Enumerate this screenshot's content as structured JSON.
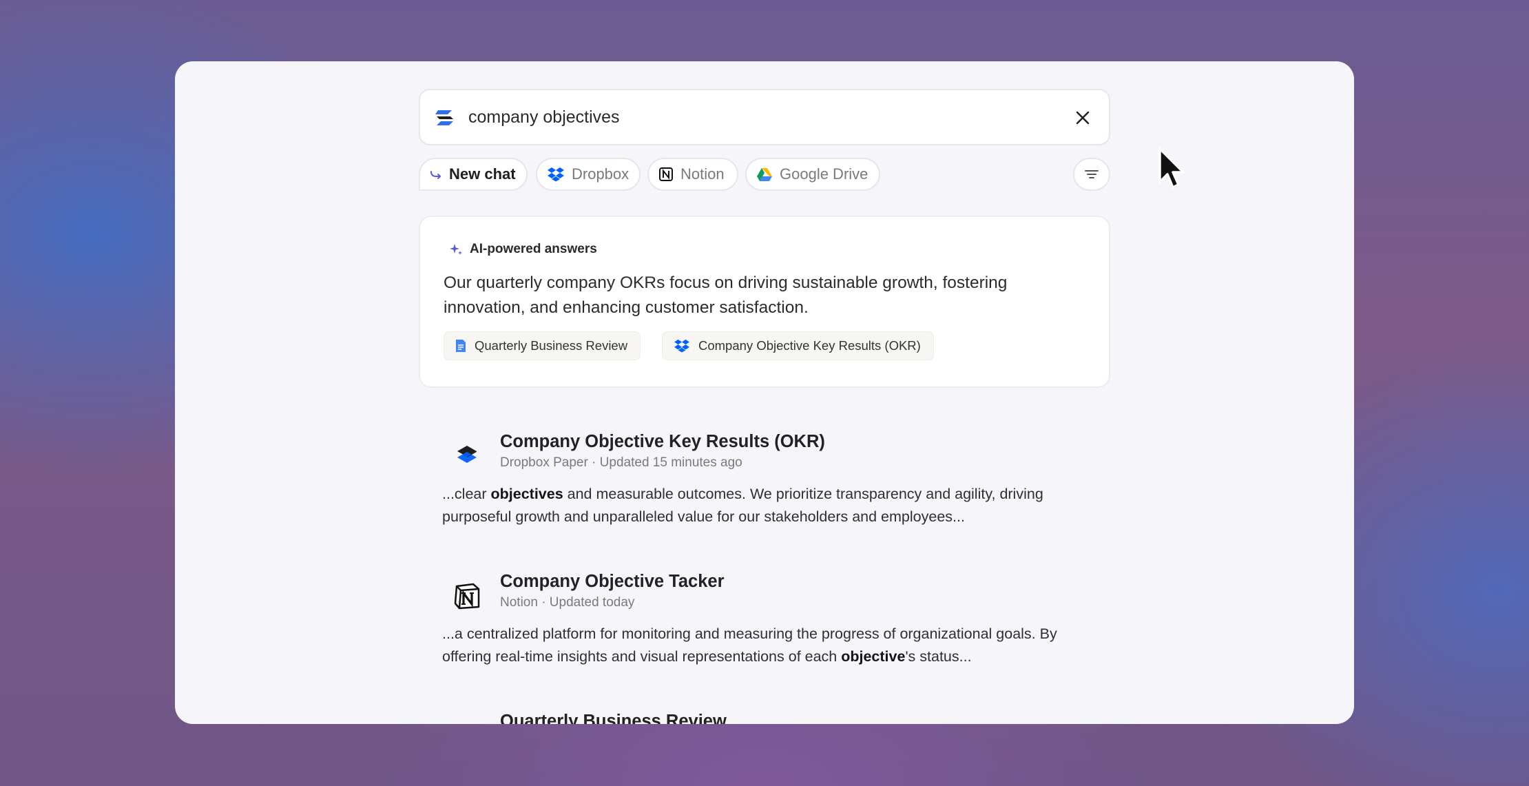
{
  "search": {
    "query": "company objectives"
  },
  "chips": {
    "new_chat": "New chat",
    "sources": [
      "Dropbox",
      "Notion",
      "Google Drive"
    ]
  },
  "ai_answer": {
    "heading": "AI-powered answers",
    "text": "Our quarterly company OKRs focus on driving sustainable growth, fostering innovation, and enhancing customer satisfaction.",
    "sources": [
      {
        "label": "Quarterly Business Review",
        "icon": "google-docs-icon"
      },
      {
        "label": "Company Objective Key Results (OKR)",
        "icon": "dropbox-icon"
      }
    ]
  },
  "results": [
    {
      "title": "Company Objective Key Results (OKR)",
      "meta": "Dropbox Paper · Updated 15 minutes ago",
      "icon": "dropbox-paper-icon",
      "snippet_before": "...clear ",
      "snippet_bold": "objectives",
      "snippet_after": " and measurable outcomes. We prioritize transparency and agility, driving purposeful growth and unparalleled value for our stakeholders and employees..."
    },
    {
      "title": "Company Objective Tacker",
      "meta": "Notion · Updated today",
      "icon": "notion-icon",
      "snippet_before": "...a centralized platform for monitoring and measuring the progress of organizational goals. By offering real-time insights and visual representations of each ",
      "snippet_bold": "objective",
      "snippet_after": "'s status..."
    },
    {
      "title": "Quarterly Business Review",
      "icon": "google-docs-icon"
    }
  ],
  "colors": {
    "accent_purple": "#5b5bd6",
    "dropbox_blue": "#0061fe",
    "docs_blue": "#4285f4"
  }
}
